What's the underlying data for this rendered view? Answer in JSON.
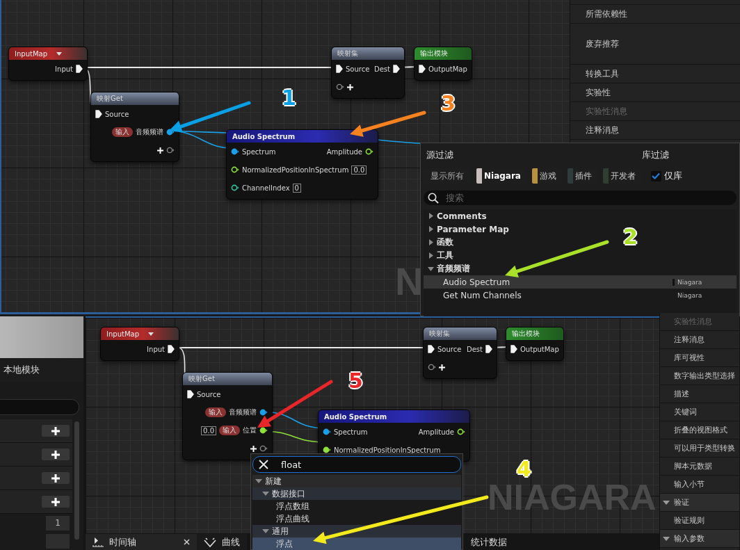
{
  "top": {
    "graph": {
      "nodes": [
        {
          "title": "InputMap",
          "kind": "input",
          "rows": [
            {
              "out": {
                "label": "Input",
                "kind": "map",
                "connected": true
              }
            }
          ]
        },
        {
          "title": "映射Get",
          "kind": "map",
          "rows": [
            {
              "in": {
                "label": "Source",
                "kind": "map",
                "connected": true
              }
            },
            {
              "out": {
                "label": "音频频谱",
                "tag": "输入",
                "kind": "spectrum",
                "connected": true
              }
            },
            {
              "out": {
                "kind": "add",
                "connected": false
              }
            }
          ]
        },
        {
          "title": "映射集",
          "kind": "map",
          "rows": [
            {
              "in": {
                "label": "Source",
                "kind": "map",
                "connected": true
              },
              "out": {
                "label": "Dest",
                "kind": "map",
                "connected": true
              }
            },
            {
              "in": {
                "kind": "add",
                "connected": false
              }
            }
          ]
        },
        {
          "title": "输出模块",
          "kind": "output",
          "rows": [
            {
              "in": {
                "label": "OutputMap",
                "kind": "map",
                "connected": true
              }
            }
          ]
        },
        {
          "title": "Audio Spectrum",
          "kind": "function",
          "rows": [
            {
              "in": {
                "label": "Spectrum",
                "kind": "spectrum",
                "connected": true
              },
              "out": {
                "label": "Amplitude",
                "kind": "float",
                "connected": false
              }
            },
            {
              "in": {
                "label": "NormalizedPositionInSpectrum",
                "kind": "float",
                "connected": false,
                "value": "0.0"
              }
            },
            {
              "in": {
                "label": "ChannelIndex",
                "kind": "int",
                "connected": false,
                "value": "0"
              }
            }
          ]
        }
      ],
      "watermark": "N"
    },
    "details": [
      {
        "label": "所需依赖性",
        "kind": "item",
        "disabled": false
      },
      {
        "label": "废弃推荐",
        "kind": "textarea",
        "disabled": false
      },
      {
        "label": "转换工具",
        "kind": "item",
        "disabled": false
      },
      {
        "label": "实验性",
        "kind": "item",
        "disabled": false
      },
      {
        "label": "实验性消息",
        "kind": "item",
        "disabled": true
      },
      {
        "label": "注释消息",
        "kind": "item",
        "disabled": false
      }
    ],
    "action_menu": {
      "source_filter_title": "源过滤",
      "library_filter_title": "库过滤",
      "filters": [
        {
          "label": "显示所有",
          "kind": "all",
          "selected": false
        },
        {
          "label": "Niagara",
          "kind": "source",
          "color": "#c9bebe",
          "selected": true
        },
        {
          "label": "游戏",
          "kind": "source",
          "color": "#b8913e",
          "selected": false
        },
        {
          "label": "插件",
          "kind": "source",
          "color": "#303b3b",
          "selected": false
        },
        {
          "label": "开发者",
          "kind": "source",
          "color": "#2f3d33",
          "selected": false
        }
      ],
      "library_only": {
        "label": "仅库",
        "checked": true
      },
      "search": {
        "placeholder": "搜索"
      },
      "tree": [
        {
          "label": "Comments",
          "expanded": false
        },
        {
          "label": "Parameter Map",
          "expanded": false
        },
        {
          "label": "函数",
          "expanded": false
        },
        {
          "label": "工具",
          "expanded": false
        },
        {
          "label": "音频频谱",
          "expanded": true,
          "children": [
            {
              "label": "Audio Spectrum",
              "source": "Niagara",
              "selected": true
            },
            {
              "label": "Get Num Channels",
              "source": "Niagara",
              "selected": false
            }
          ]
        }
      ]
    },
    "annotations": [
      {
        "number": "1",
        "color": "#0aa0e6"
      },
      {
        "number": "3",
        "color": "#f5821f"
      },
      {
        "number": "2",
        "color": "#a8e02a"
      }
    ]
  },
  "bottom": {
    "module_panel": {
      "title": "本地模块",
      "number_fields": [
        "1"
      ]
    },
    "graph": {
      "nodes": [
        {
          "title": "InputMap",
          "kind": "input",
          "rows": [
            {
              "out": {
                "label": "Input",
                "kind": "map",
                "connected": true
              }
            }
          ]
        },
        {
          "title": "映射Get",
          "kind": "map",
          "rows": [
            {
              "in": {
                "label": "Source",
                "kind": "map",
                "connected": true
              }
            },
            {
              "out": {
                "label": "音频频谱",
                "tag": "输入",
                "kind": "spectrum",
                "connected": true
              }
            },
            {
              "out": {
                "label": "位置",
                "tag": "输入",
                "kind": "float",
                "connected": true,
                "value": "0.0"
              }
            },
            {
              "out": {
                "kind": "add",
                "connected": false
              }
            }
          ]
        },
        {
          "title": "映射集",
          "kind": "map",
          "rows": [
            {
              "in": {
                "label": "Source",
                "kind": "map",
                "connected": true
              },
              "out": {
                "label": "Dest",
                "kind": "map",
                "connected": true
              }
            },
            {
              "in": {
                "kind": "add",
                "connected": false
              }
            }
          ]
        },
        {
          "title": "输出模块",
          "kind": "output",
          "rows": [
            {
              "in": {
                "label": "OutputMap",
                "kind": "map",
                "connected": true
              }
            }
          ]
        },
        {
          "title": "Audio Spectrum",
          "kind": "function",
          "rows": [
            {
              "in": {
                "label": "Spectrum",
                "kind": "spectrum",
                "connected": true
              },
              "out": {
                "label": "Amplitude",
                "kind": "float",
                "connected": false
              }
            },
            {
              "in": {
                "label": "NormalizedPositionInSpectrum",
                "kind": "float",
                "connected": true
              }
            }
          ]
        }
      ],
      "watermark": "NIAGARA"
    },
    "tabs": [
      {
        "label": "时间轴",
        "kind": "timeline",
        "selected": true
      },
      {
        "label": "曲线",
        "kind": "curves",
        "selected": false
      },
      {
        "label": "统计数据",
        "kind": "plain",
        "selected": false
      }
    ],
    "action_menu": {
      "search": {
        "value": "float"
      },
      "tree": [
        {
          "label": "新建",
          "expanded": true,
          "children": [
            {
              "label": "数据接口",
              "expanded": true,
              "children": [
                {
                  "label": "浮点数组",
                  "selected": false
                },
                {
                  "label": "浮点曲线",
                  "selected": false
                }
              ]
            },
            {
              "label": "通用",
              "expanded": true,
              "children": [
                {
                  "label": "浮点",
                  "selected": true
                }
              ]
            }
          ]
        }
      ]
    },
    "details": [
      {
        "label": "实验性消息",
        "kind": "item",
        "disabled": true
      },
      {
        "label": "注释消息",
        "kind": "item",
        "disabled": false
      },
      {
        "label": "库可视性",
        "kind": "item",
        "disabled": false
      },
      {
        "label": "数字输出类型选择",
        "kind": "item",
        "disabled": false
      },
      {
        "label": "描述",
        "kind": "item",
        "disabled": false
      },
      {
        "label": "关键词",
        "kind": "item",
        "disabled": false
      },
      {
        "label": "折叠的视图格式",
        "kind": "item",
        "disabled": false
      },
      {
        "label": "可以用于类型转换",
        "kind": "item",
        "disabled": false
      },
      {
        "label": "脚本元数据",
        "kind": "item",
        "disabled": false
      },
      {
        "label": "输入小节",
        "kind": "item",
        "disabled": false
      },
      {
        "label": "验证",
        "kind": "category",
        "expanded": true,
        "disabled": false
      },
      {
        "label": "验证规则",
        "kind": "item",
        "disabled": false
      },
      {
        "label": "输入参数",
        "kind": "category",
        "expanded": true,
        "disabled": false
      }
    ],
    "annotations": [
      {
        "number": "5",
        "color": "#e8262a"
      },
      {
        "number": "4",
        "color": "#f2ea1c"
      }
    ]
  }
}
